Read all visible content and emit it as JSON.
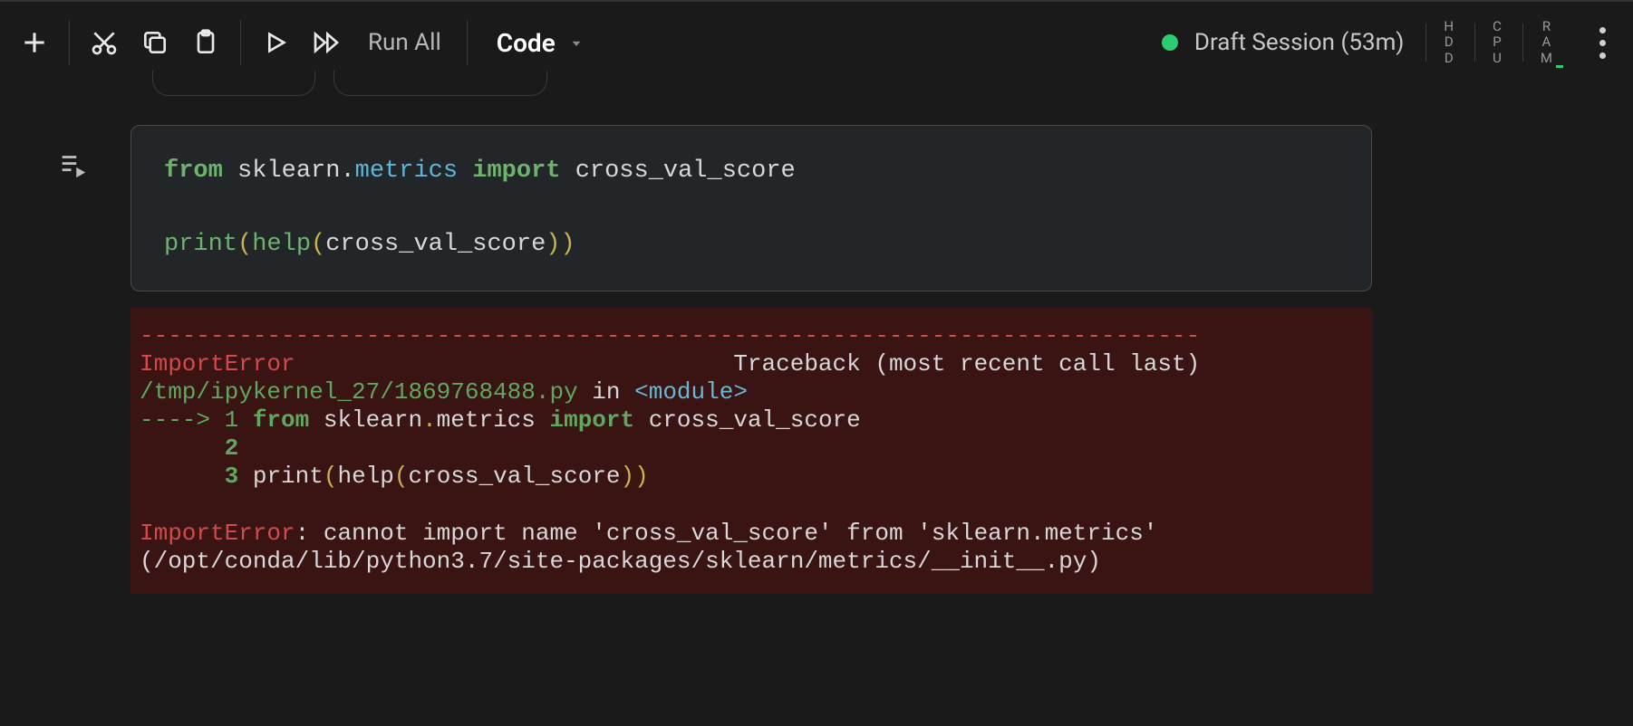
{
  "toolbar": {
    "run_all_label": "Run All",
    "cell_type_label": "Code"
  },
  "session": {
    "label": "Draft Session (53m)"
  },
  "resources": {
    "hdd": "HDD",
    "cpu": "CPU",
    "ram": "RAM"
  },
  "code": {
    "kw_from": "from",
    "mod_sklearn": " sklearn",
    "dot1": ".",
    "mod_metrics": "metrics",
    "sp1": " ",
    "kw_import": "import",
    "sp2": " ",
    "id_cross": "cross_val_score",
    "blank": "",
    "fn_print": "print",
    "p_open1": "(",
    "fn_help": "help",
    "p_open2": "(",
    "id_cross2": "cross_val_score",
    "p_close2": ")",
    "p_close1": ")"
  },
  "traceback": {
    "dashes": "---------------------------------------------------------------------------",
    "err_name": "ImportError",
    "err_right": "                               Traceback (most recent call last)",
    "path": "/tmp/ipykernel_27/1869768488.py",
    "in": " in ",
    "module": "<module>",
    "arrow": "----> 1",
    "l1_from": " from",
    "l1_sklearn": " sklearn",
    "l1_dot": ".",
    "l1_metrics": "metrics ",
    "l1_import": "import",
    "l1_cross": " cross_val_score",
    "l2_num": "      2",
    "l3_num": "      3",
    "l3_body_a": " print",
    "l3_paren1": "(",
    "l3_help": "help",
    "l3_paren2": "(",
    "l3_cross": "cross_val_score",
    "l3_paren3": ")",
    "l3_paren4": ")",
    "final_err": "ImportError",
    "final_msg": ": cannot import name 'cross_val_score' from 'sklearn.metrics' (/opt/conda/lib/python3.7/site-packages/sklearn/metrics/__init__.py)"
  }
}
